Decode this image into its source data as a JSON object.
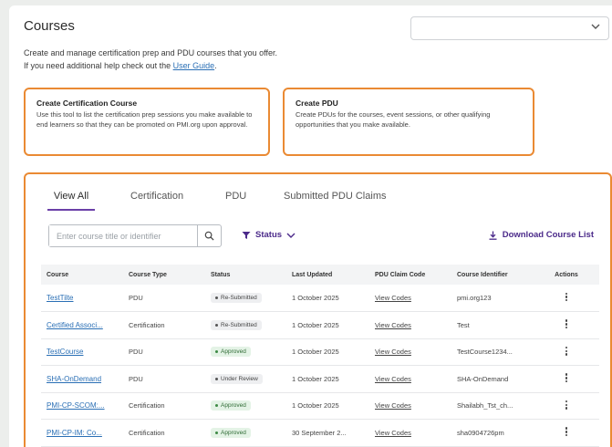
{
  "header": {
    "title": "Courses",
    "select_value": ""
  },
  "intro": {
    "line1": "Create and manage certification prep and PDU courses that you offer.",
    "line2_prefix": "If you need additional help check out the ",
    "guide_link": "User Guide",
    "line2_suffix": "."
  },
  "cards": {
    "certification": {
      "title": "Create Certification Course",
      "body": "Use this tool to list the certification prep sessions you make available to end learners so that they can be promoted on PMI.org upon approval."
    },
    "pdu": {
      "title": "Create PDU",
      "body": "Create PDUs for the courses, event sessions, or other qualifying opportunities that you make available."
    }
  },
  "tabs": [
    "View All",
    "Certification",
    "PDU",
    "Submitted PDU Claims"
  ],
  "search": {
    "placeholder": "Enter course title or identifier",
    "value": ""
  },
  "filter": {
    "label": "Status"
  },
  "download": {
    "label": "Download Course List"
  },
  "table": {
    "columns": [
      "Course",
      "Course Type",
      "Status",
      "Last Updated",
      "PDU Claim Code",
      "Course Identifier",
      "Actions"
    ],
    "rows": [
      {
        "course": "TestTilte",
        "type": "PDU",
        "status": "Re-Submitted",
        "status_kind": "neutral",
        "updated": "1 October 2025",
        "claim": "View Codes",
        "identifier": "pmi.org123"
      },
      {
        "course": "Certified Associ...",
        "type": "Certification",
        "status": "Re-Submitted",
        "status_kind": "neutral",
        "updated": "1 October 2025",
        "claim": "View Codes",
        "identifier": "Test"
      },
      {
        "course": "TestCourse",
        "type": "PDU",
        "status": "Approved",
        "status_kind": "approved",
        "updated": "1 October 2025",
        "claim": "View Codes",
        "identifier": "TestCourse1234..."
      },
      {
        "course": "SHA-OnDemand",
        "type": "PDU",
        "status": "Under Review",
        "status_kind": "neutral",
        "updated": "1 October 2025",
        "claim": "View Codes",
        "identifier": "SHA-OnDemand"
      },
      {
        "course": "PMI-CP-SCOM:...",
        "type": "Certification",
        "status": "Approved",
        "status_kind": "approved",
        "updated": "1 October 2025",
        "claim": "View Codes",
        "identifier": "Shailabh_Tst_ch..."
      },
      {
        "course": "PMI-CP-IM: Co...",
        "type": "Certification",
        "status": "Approved",
        "status_kind": "approved",
        "updated": "30 September 2...",
        "claim": "View Codes",
        "identifier": "sha0904726pm"
      }
    ]
  },
  "colors": {
    "accent_orange": "#ea8a33",
    "accent_purple": "#4b2a8a",
    "tab_underline": "#6b3fa8",
    "link_blue": "#2a6fb5",
    "approved_bg": "#e4f3e6"
  },
  "icons": {
    "select": "chevron-down-icon",
    "search": "search-icon",
    "filter": "filter-icon",
    "filter_chevron": "chevron-down-icon",
    "download": "download-icon",
    "actions": "kebab-menu-icon"
  }
}
